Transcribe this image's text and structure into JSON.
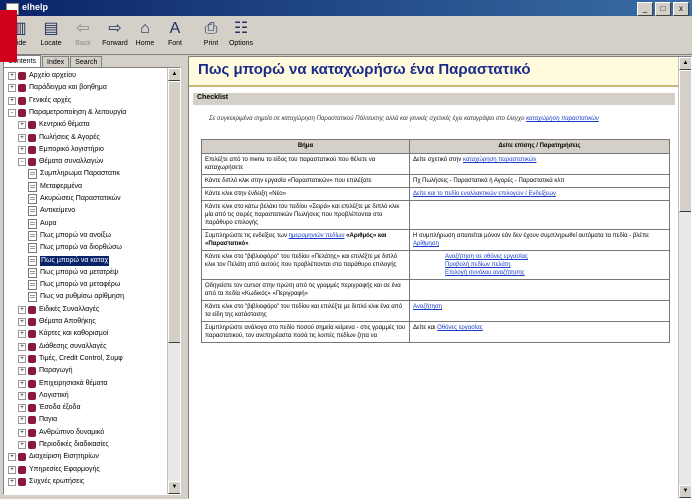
{
  "window": {
    "title": "elhelp"
  },
  "titlebar_buttons": [
    "_",
    "□",
    "x"
  ],
  "toolbar": [
    {
      "label": "Hide",
      "icon": "hide-icon",
      "glyph": "▥",
      "enabled": true
    },
    {
      "label": "Locate",
      "icon": "locate-icon",
      "glyph": "▤",
      "enabled": true
    },
    {
      "label": "Back",
      "icon": "back-icon",
      "glyph": "⇦",
      "enabled": false
    },
    {
      "label": "Forward",
      "icon": "forward-icon",
      "glyph": "⇨",
      "enabled": true
    },
    {
      "label": "Home",
      "icon": "home-icon",
      "glyph": "⌂",
      "enabled": true
    },
    {
      "label": "Font",
      "icon": "font-icon",
      "glyph": "A",
      "enabled": true
    },
    {
      "label": "Print",
      "icon": "print-icon",
      "glyph": "⎙",
      "enabled": true
    },
    {
      "label": "Options",
      "icon": "options-icon",
      "glyph": "☷",
      "enabled": true
    }
  ],
  "tabs": [
    "Contents",
    "Index",
    "Search"
  ],
  "tree": [
    {
      "label": "Αρχείο αρχείου",
      "level": 0,
      "kind": "book",
      "expand": "+"
    },
    {
      "label": "Παράδειγμα και βοηθημα",
      "level": 0,
      "kind": "book",
      "expand": "+"
    },
    {
      "label": "Γενικές αρχές",
      "level": 0,
      "kind": "book",
      "expand": "+"
    },
    {
      "label": "Παραμετροποίηση & λειτουργία",
      "level": 0,
      "kind": "book",
      "expand": "-"
    },
    {
      "label": "Κεντρικό θέματα",
      "level": 1,
      "kind": "book",
      "expand": "+"
    },
    {
      "label": "Πωλήσεις & Αγορές",
      "level": 1,
      "kind": "book",
      "expand": "+"
    },
    {
      "label": "Εμπορικό λογιστήριο",
      "level": 1,
      "kind": "book",
      "expand": "+"
    },
    {
      "label": "Θέματα συναλλαγών",
      "level": 1,
      "kind": "book",
      "expand": "-"
    },
    {
      "label": "Συμπληρωμα Παραστατικ",
      "level": 2,
      "kind": "page"
    },
    {
      "label": "Μεταφερμένα",
      "level": 2,
      "kind": "page"
    },
    {
      "label": "Ακυρώσεις Παραστατικών",
      "level": 2,
      "kind": "page"
    },
    {
      "label": "Αντικείμενο",
      "level": 2,
      "kind": "page"
    },
    {
      "label": "Αυρα",
      "level": 2,
      "kind": "page"
    },
    {
      "label": "Πως μπορώ να ανοίξω",
      "level": 2,
      "kind": "page"
    },
    {
      "label": "Πως μπορώ να διορθώσω",
      "level": 2,
      "kind": "page"
    },
    {
      "label": "Πως μπορώ να καταχ",
      "level": 2,
      "kind": "page",
      "selected": true
    },
    {
      "label": "Πως μπορώ να μετατρέψ",
      "level": 2,
      "kind": "page"
    },
    {
      "label": "Πως μπορώ να μεταφέρω",
      "level": 2,
      "kind": "page"
    },
    {
      "label": "Πως να ρυθμίσω αρίθμηση",
      "level": 2,
      "kind": "page"
    },
    {
      "label": "Ειδικές Συναλλαγές",
      "level": 1,
      "kind": "book",
      "expand": "+"
    },
    {
      "label": "Θέματα Αποθήκης",
      "level": 1,
      "kind": "book",
      "expand": "+"
    },
    {
      "label": "Κάρτες και καθορισμοί",
      "level": 1,
      "kind": "book",
      "expand": "+"
    },
    {
      "label": "Διάθεσης συναλλαγές",
      "level": 1,
      "kind": "book",
      "expand": "+"
    },
    {
      "label": "Τιμές, Credit Control, Συμφ",
      "level": 1,
      "kind": "book",
      "expand": "+"
    },
    {
      "label": "Παραγωγή",
      "level": 1,
      "kind": "book",
      "expand": "+"
    },
    {
      "label": "Επιχειρησιακά θέματα",
      "level": 1,
      "kind": "book",
      "expand": "+"
    },
    {
      "label": "Λογιστική",
      "level": 1,
      "kind": "book",
      "expand": "+"
    },
    {
      "label": "Έσοδα έξοδα",
      "level": 1,
      "kind": "book",
      "expand": "+"
    },
    {
      "label": "Παγια",
      "level": 1,
      "kind": "book",
      "expand": "+"
    },
    {
      "label": "Ανθρώπινο δυναμικό",
      "level": 1,
      "kind": "book",
      "expand": "+"
    },
    {
      "label": "Περιοδικές διαδικασίες",
      "level": 1,
      "kind": "book",
      "expand": "+"
    },
    {
      "label": "Διαχείριση Εισητηρίων",
      "level": 0,
      "kind": "book",
      "expand": "+"
    },
    {
      "label": "Υπηρεσίες Εφαρμογής",
      "level": 0,
      "kind": "book",
      "expand": "+"
    },
    {
      "label": "Συχνές ερωτήσεις",
      "level": 0,
      "kind": "book",
      "expand": "+"
    }
  ],
  "content": {
    "title": "Πως μπορώ να καταχωρήσω ένα Παραστατικό",
    "section": "Checklist",
    "intro": "Σε συγκεκριμένα σημεία σε καταχώρηση Παραστατικού Πάλτευσης αλλά και γενικές σχετικές έχει καταγράψει στο έλεγχο",
    "intro_link": "καταχώρηση παραστατικών",
    "headers": [
      "Βήμα",
      "Δείτε επίσης / Παρατηρήσεις"
    ],
    "rows": [
      {
        "step": "Επιλέξτε από το menu το είδος του παραστατικού που θέλετε να καταχωρήσετε",
        "note_text": "Δείτε σχετικό στην ",
        "note_links": [
          "καταχώρηση παραστατικών"
        ]
      },
      {
        "step": "Κάντε διπλό κλικ στην εργασία «Παραστατικών» που επιλέξατε",
        "note_text": "Πχ Πωλήσεις - Παραστατικά ή Αγορές - Παραστατικά κλπ",
        "note_links": []
      },
      {
        "step": "Κάντε κλικ στην ένδειξη «Νέο»",
        "note_text": "",
        "note_links": [
          "Δείτε και το πεδίο εναλλακτικών επιλογών / Ενδείξεων"
        ]
      },
      {
        "step": "Κάντε κλικ στο κάτω βελάκι του πεδίου «Σειρά» και επιλέξτε με διπλό κλικ μία από τις σειρές παραστατικών Πωλήσεις που προβλέπονται στο παράθυρο επιλογής",
        "note_text": "",
        "note_links": []
      },
      {
        "step": "Συμπληρώστε τις ενδείξεις των ",
        "step_link": "ημερομηνιών πεδίων",
        "step_bold": "«Αριθμός» και «Παραστατικό»",
        "note_text": "Η συμπλήρωση απαιτείται μόνον εάν δεν έχουν συμπληρωθεί αυτόματα τα πεδία - βλέπε ",
        "note_links": [
          "Αρίθμηση"
        ]
      },
      {
        "step": "Κάντε κλικ στο \"βιβλιοφόρο\" του πεδίου «Πελάτης» και επιλέξτε με διπλό κλικ τον Πελάτη από αυτούς που προβλέπονται στο παράθυρο επιλογής",
        "note_text": "",
        "note_links": [
          "Αναζήτηση σε οθόνες εργασίας",
          "Προβολή πεδίων πελάτη",
          "Επιλογή συνόλου αναζήτησης"
        ]
      },
      {
        "step": "Οδηγείστε τον cursor στην πρώτη από τις γραμμές περιγραφής και σε ένα από τα πεδία «Κωδικός» «Περιγραφή»",
        "note_text": "",
        "note_links": []
      },
      {
        "step": "Κάντε κλικ στο \"βιβλιοφόρο\" του πεδίου και επιλέξτε με διπλό κλικ ένα από τα είδη της κατάστασης",
        "note_text": "",
        "note_links": [
          "Αναζήτηση"
        ]
      },
      {
        "step": "Συμπληρώστε ανάλογα στο πεδίο ποσού σημεία κείμενα - στις γραμμές του παραστατικού, τον ανεπηρέαστα ποσά τις λοιπές πεδίων ζητα να",
        "note_text": "Δείτε και ",
        "note_links": [
          "Οθόνες εργασίας"
        ]
      }
    ]
  }
}
